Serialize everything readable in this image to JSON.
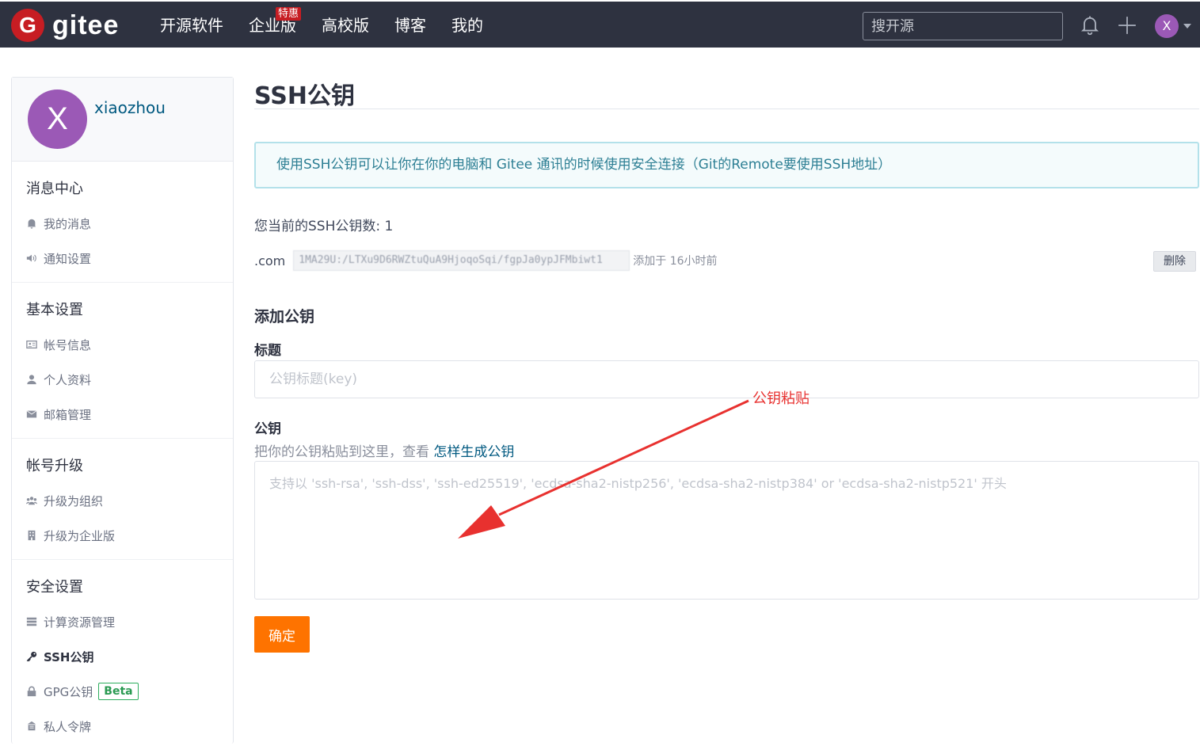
{
  "topbar": {
    "logo_mark": "G",
    "logo_text": "gitee",
    "nav": [
      {
        "label": "开源软件"
      },
      {
        "label": "企业版",
        "badge": "特惠"
      },
      {
        "label": "高校版"
      },
      {
        "label": "博客"
      },
      {
        "label": "我的"
      }
    ],
    "search_placeholder": "搜开源",
    "avatar_initial": "X"
  },
  "sidebar": {
    "avatar_initial": "X",
    "username": "xiaozhou",
    "sections": [
      {
        "title": "消息中心",
        "items": [
          {
            "label": "我的消息",
            "icon": "bell-icon"
          },
          {
            "label": "通知设置",
            "icon": "volume-icon"
          }
        ]
      },
      {
        "title": "基本设置",
        "items": [
          {
            "label": "帐号信息",
            "icon": "id-card-icon"
          },
          {
            "label": "个人资料",
            "icon": "user-icon"
          },
          {
            "label": "邮箱管理",
            "icon": "mail-icon"
          }
        ]
      },
      {
        "title": "帐号升级",
        "items": [
          {
            "label": "升级为组织",
            "icon": "users-icon"
          },
          {
            "label": "升级为企业版",
            "icon": "building-icon"
          }
        ]
      },
      {
        "title": "安全设置",
        "items": [
          {
            "label": "计算资源管理",
            "icon": "server-icon"
          },
          {
            "label": "SSH公钥",
            "icon": "key-icon",
            "active": true
          },
          {
            "label": "GPG公钥",
            "icon": "lock-icon",
            "badge": "Beta"
          },
          {
            "label": "私人令牌",
            "icon": "token-icon"
          }
        ]
      }
    ]
  },
  "main": {
    "title": "SSH公钥",
    "info": "使用SSH公钥可以让你在你的电脑和 Gitee 通讯的时候使用安全连接（Git的Remote要使用SSH地址）",
    "key_count": "您当前的SSH公钥数: 1",
    "key": {
      "name": ".com",
      "fingerprint": "1MA29U:/LTXu9D6RWZtuQuA9HjoqoSqi/fgpJa0ypJFMbiwt1",
      "time": "添加于 16小时前",
      "delete_label": "删除"
    },
    "add_title": "添加公钥",
    "label_title": "标题",
    "title_placeholder": "公钥标题(key)",
    "label_key": "公钥",
    "hint_prefix": "把你的公钥粘贴到这里，查看",
    "hint_link": "怎样生成公钥",
    "key_placeholder": "支持以 'ssh-rsa', 'ssh-dss', 'ssh-ed25519', 'ecdsa-sha2-nistp256', 'ecdsa-sha2-nistp384' or 'ecdsa-sha2-nistp521' 开头",
    "submit_label": "确定"
  },
  "annotation": {
    "text": "公钥粘贴",
    "color": "#e8312f"
  },
  "colors": {
    "topbar_bg": "#2e3240",
    "brand_red": "#c71d23",
    "submit_orange": "#fe7300",
    "avatar_purple": "#9b59b6"
  }
}
